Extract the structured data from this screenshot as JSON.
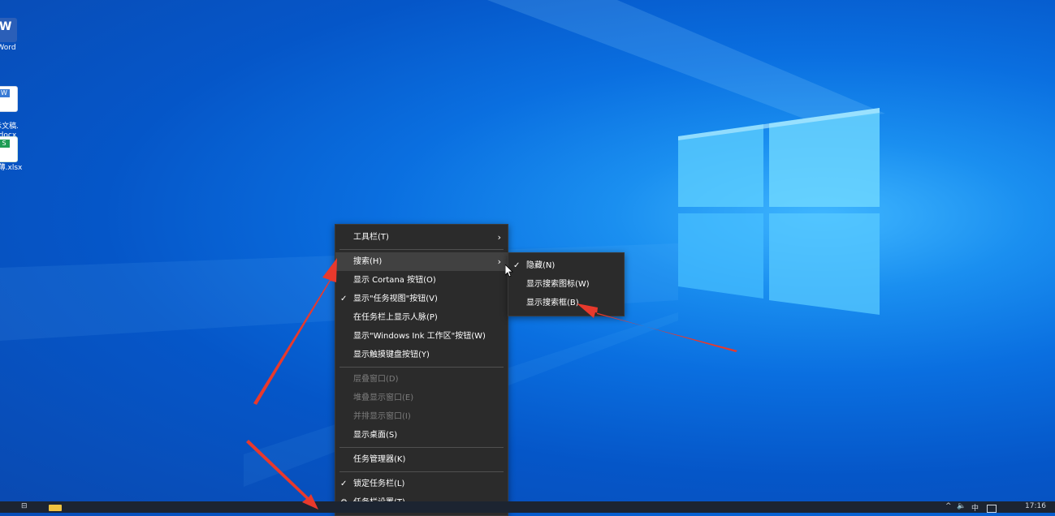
{
  "desktop_icons": [
    {
      "label": "Word",
      "icon": "word-icon",
      "color": "#2b5fb8"
    },
    {
      "label": "示文稿.\n.docx",
      "icon": "docx-icon",
      "color": "#3a7bd5"
    },
    {
      "label": "作薄.xlsx",
      "icon": "xlsx-icon",
      "color": "#1f9d55"
    }
  ],
  "context_menu": {
    "items": [
      {
        "label": "工具栏(T)",
        "submenu": true
      },
      {
        "label": "搜索(H)",
        "submenu": true,
        "highlighted": true
      },
      {
        "label": "显示 Cortana 按钮(O)"
      },
      {
        "label": "显示\"任务视图\"按钮(V)",
        "checked": true
      },
      {
        "label": "在任务栏上显示人脉(P)"
      },
      {
        "label": "显示\"Windows Ink 工作区\"按钮(W)"
      },
      {
        "label": "显示触摸键盘按钮(Y)"
      },
      {
        "label": "层叠窗口(D)",
        "disabled": true
      },
      {
        "label": "堆叠显示窗口(E)",
        "disabled": true
      },
      {
        "label": "并排显示窗口(I)",
        "disabled": true
      },
      {
        "label": "显示桌面(S)"
      },
      {
        "label": "任务管理器(K)"
      },
      {
        "label": "锁定任务栏(L)",
        "checked": true
      },
      {
        "label": "任务栏设置(T)",
        "icon": "gear-icon"
      }
    ]
  },
  "search_submenu": {
    "items": [
      {
        "label": "隐藏(N)",
        "checked": true
      },
      {
        "label": "显示搜索图标(W)"
      },
      {
        "label": "显示搜索框(B)"
      }
    ]
  },
  "taskbar": {
    "clock": "17:16",
    "tray_lang": "中"
  },
  "colors": {
    "menu_bg": "#2b2b2b",
    "menu_highlight": "#414141",
    "arrow": "#e8392c",
    "taskbar": "#1c2431"
  }
}
